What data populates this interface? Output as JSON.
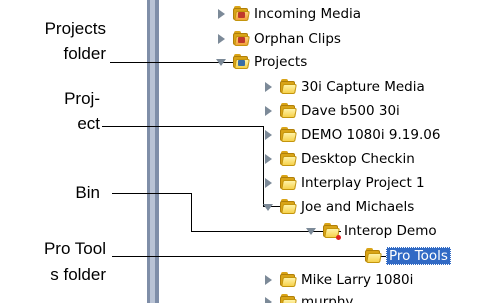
{
  "callouts": {
    "projects_folder": [
      "Projects",
      "folder"
    ],
    "project": [
      "Proj-",
      "ect"
    ],
    "bin": "Bin",
    "pro_tools_folder": [
      "Pro Tool",
      "s folder"
    ]
  },
  "tree": {
    "items": [
      {
        "label": "Incoming Media",
        "state": "collapsed",
        "icon": "special-folder-icon"
      },
      {
        "label": "Orphan Clips",
        "state": "collapsed",
        "icon": "orphan-clips-icon"
      },
      {
        "label": "Projects",
        "state": "expanded",
        "icon": "projects-folder-icon"
      },
      {
        "label": "30i Capture Media",
        "state": "collapsed",
        "icon": "folder-icon"
      },
      {
        "label": "Dave b500 30i",
        "state": "collapsed",
        "icon": "folder-icon"
      },
      {
        "label": "DEMO 1080i 9.19.06",
        "state": "collapsed",
        "icon": "folder-icon"
      },
      {
        "label": "Desktop Checkin",
        "state": "collapsed",
        "icon": "folder-icon"
      },
      {
        "label": "Interplay Project 1",
        "state": "collapsed",
        "icon": "folder-icon"
      },
      {
        "label": "Joe and Michaels",
        "state": "expanded",
        "icon": "folder-icon"
      },
      {
        "label": "Interop Demo",
        "state": "expanded",
        "icon": "folder-icon"
      },
      {
        "label": "Pro Tools",
        "state": "selected",
        "icon": "folder-icon"
      },
      {
        "label": "Mike Larry 1080i",
        "state": "collapsed",
        "icon": "folder-icon"
      },
      {
        "label": "murphy",
        "state": "collapsed",
        "icon": "folder-icon"
      }
    ]
  },
  "colors": {
    "selection": "#316ac5",
    "splitter": "#7f8ea8",
    "folder": "#f6d14b"
  }
}
